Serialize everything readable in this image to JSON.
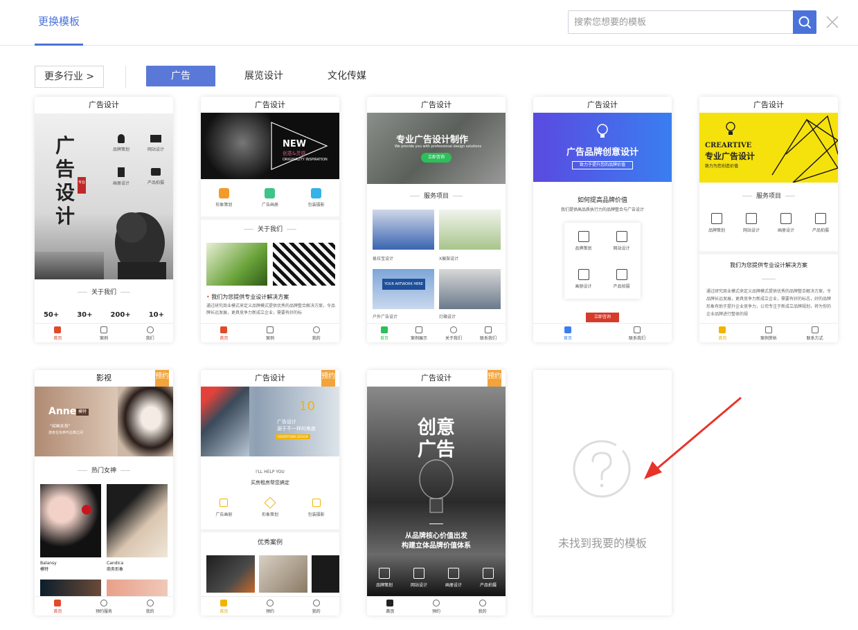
{
  "header": {
    "tab_label": "更换模板",
    "search_placeholder": "搜索您想要的模板"
  },
  "filter": {
    "more_label": "更多行业 >",
    "categories": [
      "广告",
      "展览设计",
      "文化传媒"
    ],
    "active_index": 0
  },
  "cards": [
    {
      "title": "广告设计",
      "hero_title": "广告设计",
      "hero_seal": "专业",
      "features": [
        "品牌策划",
        "网站设计",
        "画册设计",
        "产品拍摄"
      ],
      "section": "关于我们",
      "stats": [
        "50+",
        "30+",
        "200+",
        "10+"
      ],
      "nav": [
        "首页",
        "案例",
        "我们"
      ]
    },
    {
      "title": "广告设计",
      "banner_big": "NEW",
      "banner_sub": "创意&灵感",
      "banner_en": "ORIGINALITY INSPIRATION",
      "features": [
        "形象策划",
        "广告画册",
        "包装摄影"
      ],
      "section": "关于我们",
      "headline": "我们为您提供专业设计解决方案",
      "body": "通过研究商业模式来定义品牌模式提供优秀的品牌整合解决方案，令品牌长远发展，更具竞争力新成立企业，需要有好的标",
      "nav": [
        "首页",
        "案例",
        "我的"
      ]
    },
    {
      "title": "广告设计",
      "banner_title": "专业广告设计制作",
      "banner_en": "We provide you with professional design solutions",
      "banner_btn": "立即咨询",
      "section": "服务项目",
      "items": [
        "易拉宝设计",
        "X展架设计",
        "户外广告设计",
        "灯箱设计"
      ],
      "board_text": "YOUR ARTWORK HERE",
      "nav": [
        "首页",
        "案例展示",
        "关于我们",
        "联系我们"
      ]
    },
    {
      "title": "广告设计",
      "banner_title": "广告品牌创意设计",
      "banner_sub": "致力于提升您的品牌价值",
      "heading": "如何提高品牌价值",
      "sub": "我们提供高品质执行力的品牌整合与广告设计",
      "features": [
        "品牌策划",
        "网站设计",
        "画册设计",
        "产品拍摄"
      ],
      "button": "立即咨询",
      "nav": [
        "首页",
        "联系我们"
      ]
    },
    {
      "title": "广告设计",
      "banner_en": "CREARTIVE",
      "banner_title": "专业广告设计",
      "banner_sub": "致力为您创造价值",
      "section": "服务项目",
      "features": [
        "品牌策划",
        "网站设计",
        "画册设计",
        "产品拍摄"
      ],
      "heading": "我们为您提供专业设计解决方案",
      "body": "通过研究商业模式来定义品牌模式提供优秀的品牌整合解决方案，令品牌长远发展，更具竞争力新成立企业，需要有好的标志，好的品牌形象有助于提升企业竞争力，公司专注于新成立品牌规划，将为你的企业品牌进行整体的规",
      "nav": [
        "首页",
        "案例赏析",
        "联系方式"
      ]
    },
    {
      "title": "影视",
      "ribbon": "预约",
      "banner_name": "Anne",
      "banner_tag": "模特",
      "banner_quote": "\"如画女孩\"",
      "banner_line": "游走在东西与古典之间",
      "section": "热门女神",
      "people": [
        {
          "name": "Balansy",
          "role": "模特"
        },
        {
          "name": "Candica",
          "role": "商务形象"
        }
      ],
      "nav": [
        "首页",
        "预约服务",
        "我的"
      ]
    },
    {
      "title": "广告设计",
      "ribbon": "预约",
      "banner_num": "10",
      "banner_title": "广告设计",
      "banner_sub": "源于不一样的角度",
      "banner_tag": "ADVERTISING DESIGN",
      "help_en": "I'LL HELP YOU",
      "help_cn": "买房租房帮您搞定",
      "features": [
        "广告画册",
        "形象策划",
        "包装摄影"
      ],
      "section": "优秀案例",
      "nav": [
        "首页",
        "预约",
        "我的"
      ]
    },
    {
      "title": "广告设计",
      "ribbon": "预约",
      "banner_title_1": "创意",
      "banner_title_2": "广告",
      "line1": "从品牌核心价值出发",
      "line2": "构建立体品牌价值体系",
      "features": [
        "品牌策划",
        "网站设计",
        "画册设计",
        "产品拍摄"
      ],
      "nav": [
        "首页",
        "预约",
        "我的"
      ]
    }
  ],
  "empty_card": {
    "label": "未找到我要的模板"
  },
  "colors": {
    "accent": "#4a72d9",
    "active_category": "#5a78d8",
    "ribbon": "#f2a43a",
    "arrow": "#e8332a"
  }
}
